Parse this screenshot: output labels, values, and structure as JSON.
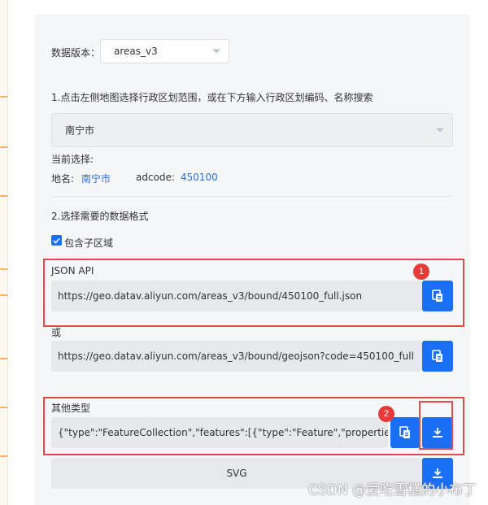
{
  "version": {
    "label": "数据版本：",
    "selected": "areas_v3"
  },
  "step1": {
    "instruction": "1.点击左侧地图选择行政区划范围，或在下方输入行政区划编码、名称搜索",
    "region_selected": "南宁市",
    "current_label": "当前选择:",
    "name_label": "地名:",
    "name_value": "南宁市",
    "adcode_label": "adcode:",
    "adcode_value": "450100"
  },
  "step2": {
    "instruction": "2.选择需要的数据格式",
    "include_children_label": "包含子区域",
    "include_children_checked": true
  },
  "json_api": {
    "label": "JSON API",
    "url": "https://geo.datav.aliyun.com/areas_v3/bound/450100_full.json",
    "or_label": "或",
    "alt_url": "https://geo.datav.aliyun.com/areas_v3/bound/geojson?code=450100_full"
  },
  "other_types": {
    "label": "其他类型",
    "geojson_preview": "{\"type\":\"FeatureCollection\",\"features\":[{\"type\":\"Feature\",\"properties\":{\"a",
    "svg_label": "SVG"
  },
  "annotations": {
    "badge1": "1",
    "badge2": "2",
    "red_color": "#e34a4a"
  },
  "colors": {
    "primary": "#1a6ff5",
    "link": "#2f6fd8"
  },
  "watermark": "CSDN @爱吃雪糕的小布丁"
}
